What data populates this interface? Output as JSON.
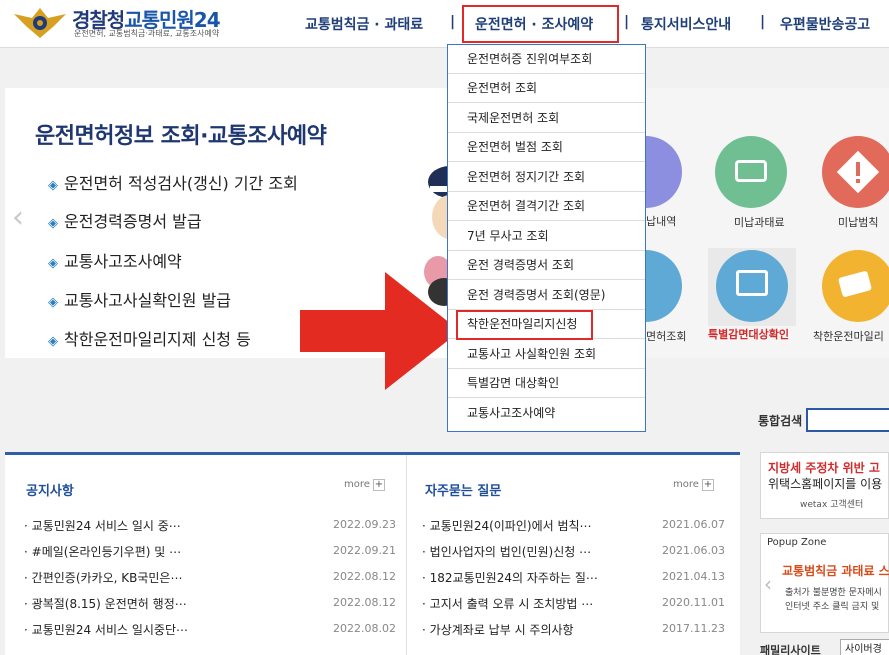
{
  "header": {
    "logo_main": "경찰청",
    "logo_accent": "교통민원24",
    "logo_sub": "운전면허, 교통범칙금·과태료, 교통조사예약"
  },
  "gnav": [
    {
      "label": "교통범칙금 · 과태료"
    },
    {
      "label": "운전면허 · 조사예약"
    },
    {
      "label": "통지서비스안내"
    },
    {
      "label": "우편물반송공고"
    }
  ],
  "gnav_separator": "|",
  "dropdown": [
    "운전면허증 진위여부조회",
    "운전면허 조회",
    "국제운전면허 조회",
    "운전면허 벌점 조회",
    "운전면허 정지기간 조회",
    "운전면허 결격기간 조회",
    "7년 무사고 조회",
    "운전 경력증명서 조회",
    "운전 경력증명서 조회(영문)",
    "착한운전마일리지신청",
    "교통사고 사실확인원 조회",
    "특별감면 대상확인",
    "교통사고조사예약"
  ],
  "banner": {
    "title": "운전면허정보 조회·교통조사예약",
    "bullet": "◈",
    "items": [
      "운전면허 적성검사(갱신) 기간 조회",
      "운전경력증명서 발급",
      "교통사고조사예약",
      "교통사고사실확인원 발급",
      "착한운전마일리지제 신청 등"
    ],
    "prev_arrow": "‹"
  },
  "quick_links": {
    "row1": [
      "납내역",
      "미납과태료",
      "미납범칙"
    ],
    "row2": [
      "면허조회",
      "특별감면대상확인",
      "착한운전마일리"
    ],
    "highlight_color": "#d12b2b"
  },
  "search": {
    "label": "통합검색"
  },
  "notice": {
    "title": "공지사항",
    "more": "more",
    "more_icon": "+",
    "rows": [
      {
        "title": "교통민원24 서비스 일시 중⋯",
        "date": "2022.09.23"
      },
      {
        "title": "#메일(온라인등기우편) 및 ⋯",
        "date": "2022.09.21"
      },
      {
        "title": "간편인증(카카오, KB국민은⋯",
        "date": "2022.08.12"
      },
      {
        "title": "광복절(8.15) 운전면허 행정⋯",
        "date": "2022.08.12"
      },
      {
        "title": "교통민원24 서비스 일시중단⋯",
        "date": "2022.08.02"
      }
    ]
  },
  "faq": {
    "title": "자주묻는 질문",
    "more": "more",
    "more_icon": "+",
    "rows": [
      {
        "title": "교통민원24(이파인)에서 범칙⋯",
        "date": "2021.06.07"
      },
      {
        "title": "법인사업자의 법인(민원)신청 ⋯",
        "date": "2021.06.03"
      },
      {
        "title": "182교통민원24의 자주하는 질⋯",
        "date": "2021.04.13"
      },
      {
        "title": "고지서 출력 오류 시 조치방법 ⋯",
        "date": "2020.11.01"
      },
      {
        "title": "가상계좌로 납부 시 주의사항",
        "date": "2017.11.23"
      }
    ]
  },
  "side_ad": {
    "line1": "지방세 주정차 위반 고",
    "line2": "위택스홈페이지를 이용",
    "line3": "wetax 고객센터"
  },
  "popup": {
    "title": "Popup Zone",
    "headline": "교통범칙금 과태료 스",
    "body1": "출처가 불분명한 문자메시",
    "body2": "인터넷 주소 클릭 금지 및",
    "prev_arrow": "‹"
  },
  "family_site": {
    "label": "패밀리사이트",
    "selected": "사이버경"
  },
  "bullet_dot": "·"
}
